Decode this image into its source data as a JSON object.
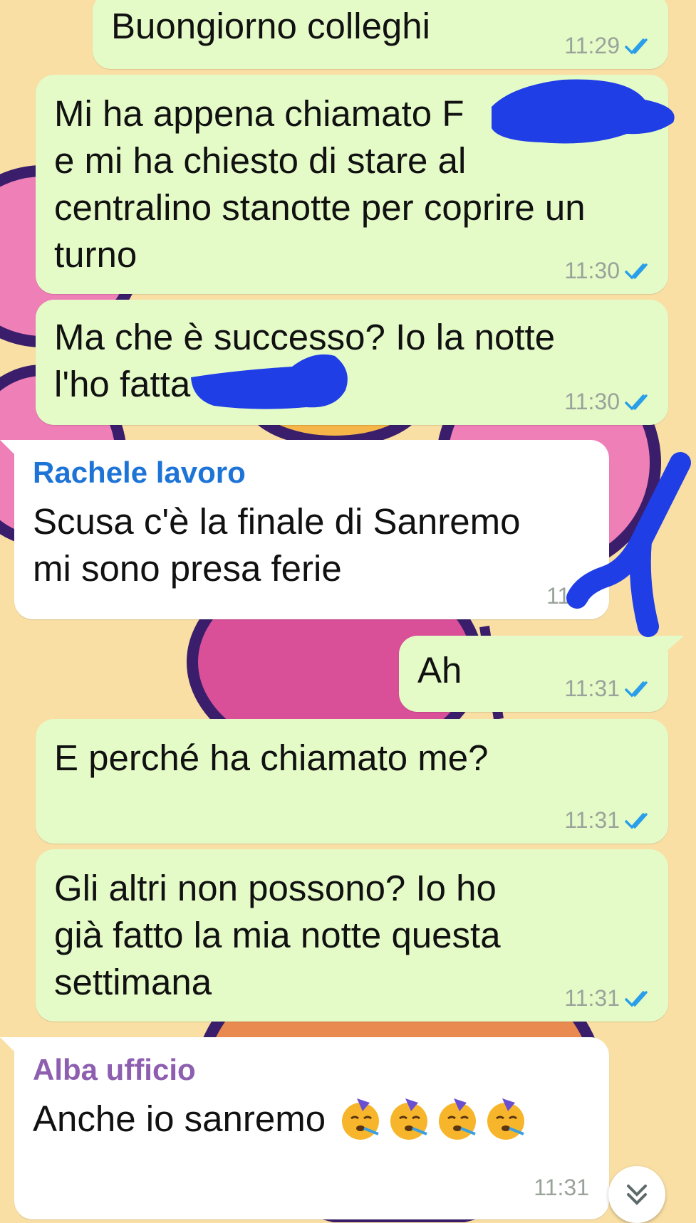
{
  "colors": {
    "outgoing_bubble": "#e4fbc8",
    "incoming_bubble": "#ffffff",
    "read_ticks": "#2a9ee8",
    "rachele_name": "#1e74d6",
    "alba_name": "#8e5fb0",
    "redaction": "#1f3ee6"
  },
  "messages": [
    {
      "text": "Buongiorno colleghi",
      "time": "11:29"
    },
    {
      "text": "Mi ha appena chiamato F\ne mi ha chiesto di stare al\ncentralino stanotte per coprire un\nturno",
      "time": "11:30"
    },
    {
      "text": "Ma che è successo? Io la notte\nl'ho fatta",
      "time": "11:30"
    },
    {
      "sender": "Rachele lavoro",
      "text": "Scusa c'è la finale di Sanremo\nmi sono presa ferie",
      "time": "11:3"
    },
    {
      "text": "Ah",
      "time": "11:31"
    },
    {
      "text": "E perché ha chiamato me?",
      "time": "11:31"
    },
    {
      "text": "Gli altri non possono? Io ho\ngià fatto la mia notte questa\nsettimana",
      "time": "11:31"
    },
    {
      "sender": "Alba ufficio",
      "text": "Anche io sanremo",
      "time": "11:31"
    }
  ],
  "icons": {
    "read_receipt": "double-check-icon",
    "scroll_down": "chevron-double-down-icon",
    "party_emoji": "partying-face-icon"
  }
}
